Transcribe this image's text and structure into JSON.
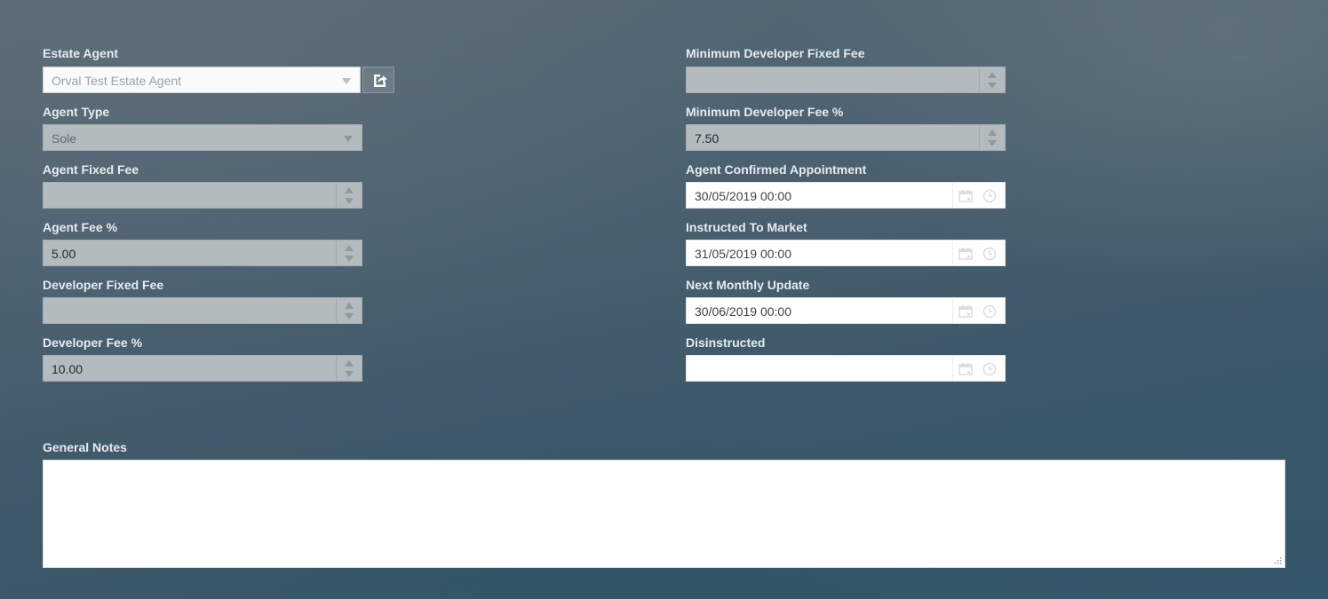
{
  "left_column": {
    "estate_agent": {
      "label": "Estate Agent",
      "value": "Orval Test Estate Agent"
    },
    "agent_type": {
      "label": "Agent Type",
      "value": "Sole"
    },
    "agent_fixed_fee": {
      "label": "Agent Fixed Fee",
      "value": ""
    },
    "agent_fee_pct": {
      "label": "Agent Fee %",
      "value": "5.00"
    },
    "developer_fixed_fee": {
      "label": "Developer Fixed Fee",
      "value": ""
    },
    "developer_fee_pct": {
      "label": "Developer Fee %",
      "value": "10.00"
    }
  },
  "right_column": {
    "min_developer_fixed_fee": {
      "label": "Minimum Developer Fixed Fee",
      "value": ""
    },
    "min_developer_fee_pct": {
      "label": "Minimum Developer Fee %",
      "value": "7.50"
    },
    "agent_confirmed_appointment": {
      "label": "Agent Confirmed Appointment",
      "value": "30/05/2019 00:00"
    },
    "instructed_to_market": {
      "label": "Instructed To Market",
      "value": "31/05/2019 00:00"
    },
    "next_monthly_update": {
      "label": "Next Monthly Update",
      "value": "30/06/2019 00:00"
    },
    "disinstructed": {
      "label": "Disinstructed",
      "value": ""
    }
  },
  "general_notes": {
    "label": "General Notes",
    "value": ""
  },
  "icons": {
    "open_button": "open-external-icon",
    "calendar": "calendar-icon",
    "clock": "clock-icon"
  },
  "colors": {
    "label_text": "#e6ebee",
    "disabled_field": "#b3bbbf",
    "enabled_field": "#ffffff"
  }
}
